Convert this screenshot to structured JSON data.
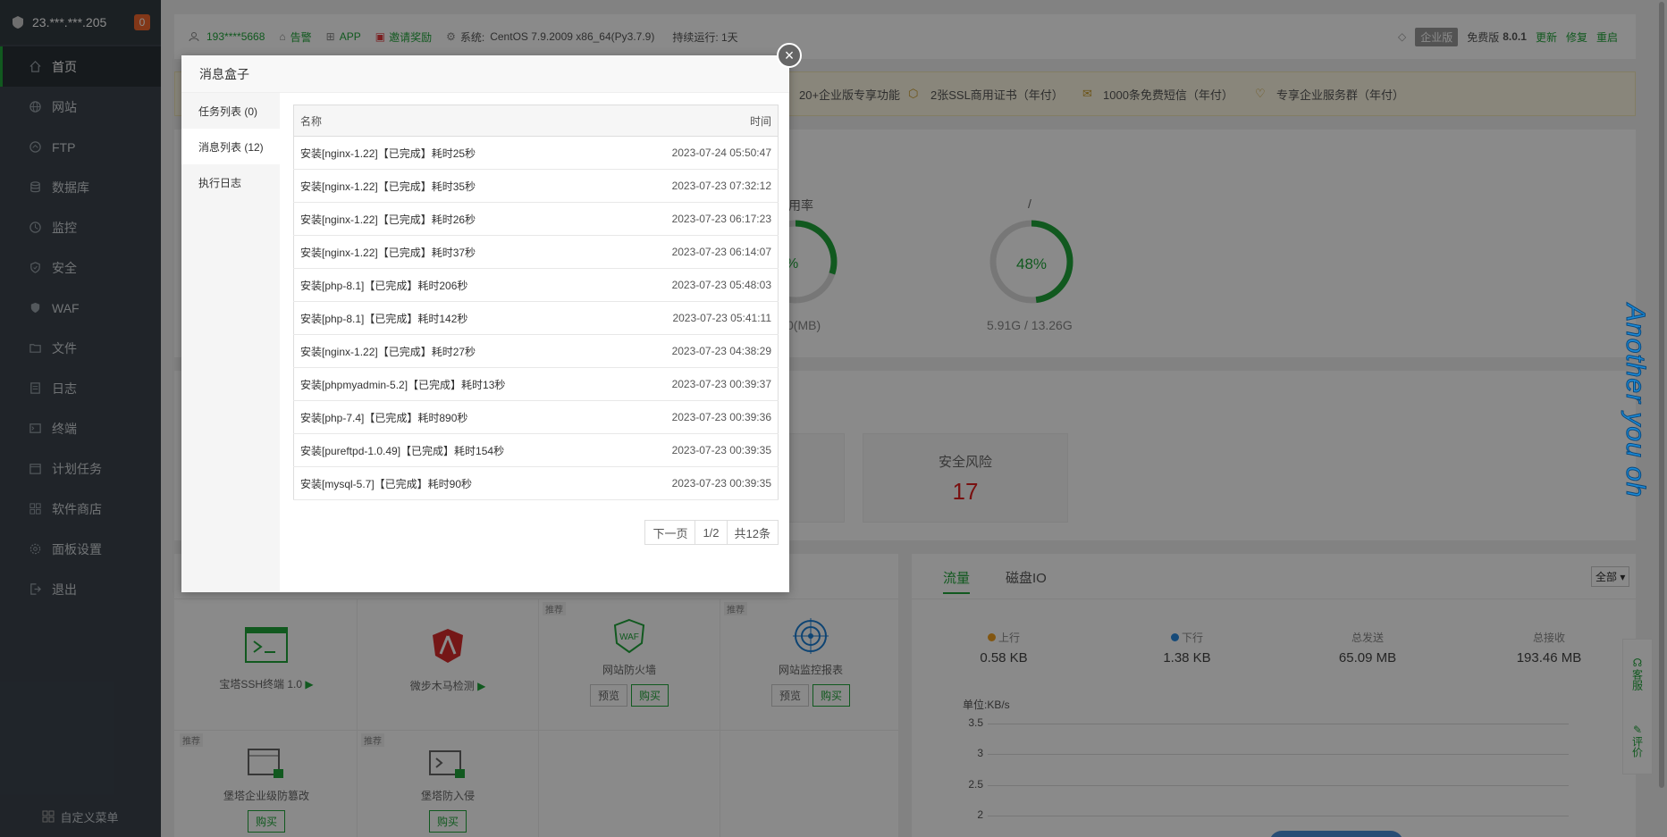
{
  "sidebar": {
    "ip": "23.***.***.205",
    "badge": "0",
    "items": [
      {
        "label": "首页",
        "icon": "home-icon"
      },
      {
        "label": "网站",
        "icon": "globe-icon"
      },
      {
        "label": "FTP",
        "icon": "ftp-icon"
      },
      {
        "label": "数据库",
        "icon": "database-icon"
      },
      {
        "label": "监控",
        "icon": "monitor-icon"
      },
      {
        "label": "安全",
        "icon": "shield-icon"
      },
      {
        "label": "WAF",
        "icon": "waf-icon"
      },
      {
        "label": "文件",
        "icon": "folder-icon"
      },
      {
        "label": "日志",
        "icon": "log-icon"
      },
      {
        "label": "终端",
        "icon": "terminal-icon"
      },
      {
        "label": "计划任务",
        "icon": "calendar-icon"
      },
      {
        "label": "软件商店",
        "icon": "grid-icon"
      },
      {
        "label": "面板设置",
        "icon": "gear-icon"
      },
      {
        "label": "退出",
        "icon": "logout-icon"
      }
    ],
    "footer": "自定义菜单"
  },
  "topbar": {
    "user": "193****5668",
    "alert": "告警",
    "app": "APP",
    "invite": "邀请奖励",
    "system_label": "系统:",
    "system_value": "CentOS 7.9.2009 x86_64(Py3.7.9)",
    "uptime": "持续运行: 1天",
    "edition_tag": "企业版",
    "edition": "免费版",
    "version": "8.0.1",
    "update": "更新",
    "repair": "修复",
    "restart": "重启"
  },
  "promo": {
    "items": [
      "20+企业版专享功能",
      "2张SSL商用证书（年付）",
      "1000条免费短信（年付）",
      "专享企业服务群（年付）"
    ]
  },
  "overview": {
    "mem_label": "用率",
    "mem_sub": "0(MB)",
    "mem_pct": "%",
    "disk_label": "/",
    "disk_pct": "48%",
    "disk_sub": "5.91G / 13.26G",
    "disk_fill": 0.48,
    "mem_fill": 0.3
  },
  "security": {
    "risk_title": "安全风险",
    "risk_count": "17"
  },
  "software": [
    {
      "name": "宝塔SSH终端 1.0",
      "tag": ""
    },
    {
      "name": "微步木马检测",
      "tag": ""
    },
    {
      "name": "网站防火墙",
      "tag": "推荐",
      "preview": "预览",
      "buy": "购买"
    },
    {
      "name": "网站监控报表",
      "tag": "推荐",
      "preview": "预览",
      "buy": "购买"
    },
    {
      "name": "堡塔企业级防篡改",
      "tag": "推荐",
      "buy": "购买"
    },
    {
      "name": "堡塔防入侵",
      "tag": "推荐",
      "buy": "购买"
    }
  ],
  "flow": {
    "tab_traffic": "流量",
    "tab_io": "磁盘IO",
    "select": "全部",
    "up_label": "上行",
    "up_value": "0.58 KB",
    "down_label": "下行",
    "down_value": "1.38 KB",
    "sent_label": "总发送",
    "sent_value": "65.09 MB",
    "recv_label": "总接收",
    "recv_value": "193.46 MB",
    "unit": "单位:KB/s",
    "yticks": [
      "3.5",
      "3",
      "2.5",
      "2"
    ]
  },
  "float": {
    "service": "客服",
    "review": "评价"
  },
  "watermark": "Another you oh",
  "modal": {
    "title": "消息盒子",
    "tabs": [
      "任务列表 (0)",
      "消息列表 (12)",
      "执行日志"
    ],
    "col_name": "名称",
    "col_time": "时间",
    "rows": [
      {
        "name": "安装[nginx-1.22]【已完成】耗时25秒",
        "time": "2023-07-24 05:50:47"
      },
      {
        "name": "安装[nginx-1.22]【已完成】耗时35秒",
        "time": "2023-07-23 07:32:12"
      },
      {
        "name": "安装[nginx-1.22]【已完成】耗时26秒",
        "time": "2023-07-23 06:17:23"
      },
      {
        "name": "安装[nginx-1.22]【已完成】耗时37秒",
        "time": "2023-07-23 06:14:07"
      },
      {
        "name": "安装[php-8.1]【已完成】耗时206秒",
        "time": "2023-07-23 05:48:03"
      },
      {
        "name": "安装[php-8.1]【已完成】耗时142秒",
        "time": "2023-07-23 05:41:11"
      },
      {
        "name": "安装[nginx-1.22]【已完成】耗时27秒",
        "time": "2023-07-23 04:38:29"
      },
      {
        "name": "安装[phpmyadmin-5.2]【已完成】耗时13秒",
        "time": "2023-07-23 00:39:37"
      },
      {
        "name": "安装[php-7.4]【已完成】耗时890秒",
        "time": "2023-07-23 00:39:36"
      },
      {
        "name": "安装[pureftpd-1.0.49]【已完成】耗时154秒",
        "time": "2023-07-23 00:39:35"
      },
      {
        "name": "安装[mysql-5.7]【已完成】耗时90秒",
        "time": "2023-07-23 00:39:35"
      }
    ],
    "pager": {
      "next": "下一页",
      "page": "1/2",
      "total": "共12条"
    },
    "close": "×"
  }
}
